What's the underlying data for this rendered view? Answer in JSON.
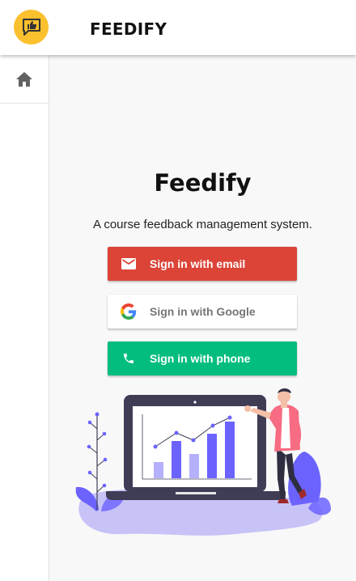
{
  "header": {
    "logo_icon": "thumbs-up-chat-icon",
    "title": "FEEDIFY",
    "accent": "#fbc02d"
  },
  "sidebar": {
    "items": [
      {
        "icon": "home-icon"
      }
    ]
  },
  "main": {
    "brand": "Feedify",
    "tagline": "A course feedback management system.",
    "buttons": {
      "email": {
        "label": "Sign in with email",
        "icon": "mail-icon",
        "color": "#db4437"
      },
      "google": {
        "label": "Sign in with Google",
        "icon": "google-icon",
        "color": "#ffffff"
      },
      "phone": {
        "label": "Sign in with phone",
        "icon": "phone-icon",
        "color": "#02bd7e"
      }
    },
    "illustration": "person-presenting-chart-on-laptop"
  }
}
